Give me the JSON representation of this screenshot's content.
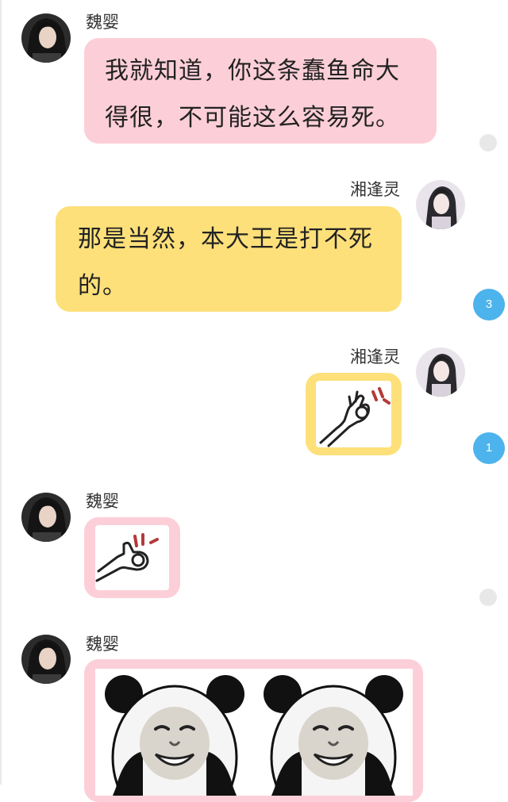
{
  "messages": [
    {
      "sender": "魏婴",
      "side": "left",
      "type": "text",
      "lines": [
        "我就知道，你这条蠢鱼命大",
        "得很，不可能这么容易死。"
      ]
    },
    {
      "sender": "湘逢灵",
      "side": "right",
      "type": "text",
      "lines": [
        "那是当然，本大王是打不死",
        "的。"
      ],
      "unread": "3"
    },
    {
      "sender": "湘逢灵",
      "side": "right",
      "type": "sticker",
      "sticker": "ok-hand-sticker",
      "unread": "1"
    },
    {
      "sender": "魏婴",
      "side": "left",
      "type": "sticker",
      "sticker": "ok-hand-sticker"
    },
    {
      "sender": "魏婴",
      "side": "left",
      "type": "sticker",
      "sticker": "panda-face-meme"
    }
  ],
  "colors": {
    "left_bubble": "#fccfd8",
    "right_bubble": "#fde07a",
    "unread_badge": "#4db3ec",
    "read_dot": "#e8e8e8"
  }
}
